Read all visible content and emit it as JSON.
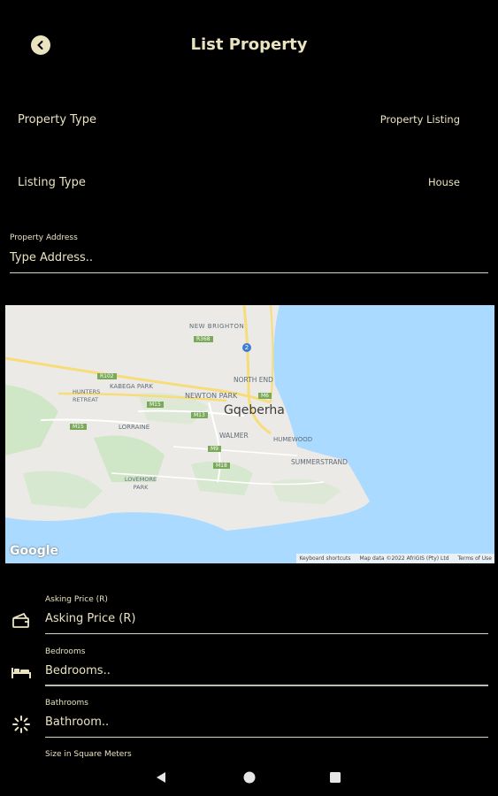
{
  "header": {
    "title": "List Property",
    "back_icon": "chevron-left-icon"
  },
  "rows": {
    "property_type": {
      "label": "Property Type",
      "value": "Property Listing"
    },
    "listing_type": {
      "label": "Listing Type",
      "value": "House"
    }
  },
  "address": {
    "label": "Property Address",
    "placeholder": "Type Address.."
  },
  "map": {
    "city": "Gqeberha",
    "places": [
      "NEW BRIGHTON",
      "NORTH END",
      "KABEGA PARK",
      "HUNTERS RETREAT",
      "NEWTON PARK",
      "LORRAINE",
      "WALMER",
      "HUMEWOOD",
      "SUMMERSTRAND",
      "LOVEMORE PARK"
    ],
    "roads": [
      "R368",
      "R102",
      "M6",
      "M15",
      "M13",
      "M15",
      "M9",
      "M18",
      "2"
    ],
    "provider": "Google",
    "shortcuts": "Keyboard shortcuts",
    "attribution": "Map data ©2022 AfriGIS (Pty) Ltd",
    "terms": "Terms of Use"
  },
  "fields": {
    "asking_price": {
      "label": "Asking Price (R)",
      "placeholder": "Asking Price (R)",
      "icon": "money-icon"
    },
    "bedrooms": {
      "label": "Bedrooms",
      "placeholder": "Bedrooms..",
      "icon": "bed-icon"
    },
    "bathrooms": {
      "label": "Bathrooms",
      "placeholder": "Bathroom..",
      "icon": "loading-icon"
    },
    "size": {
      "label": "Size in Square Meters"
    }
  },
  "colors": {
    "accent": "#e9e3c0",
    "background": "#000000",
    "water": "#aadaff",
    "land": "#eceae6"
  }
}
